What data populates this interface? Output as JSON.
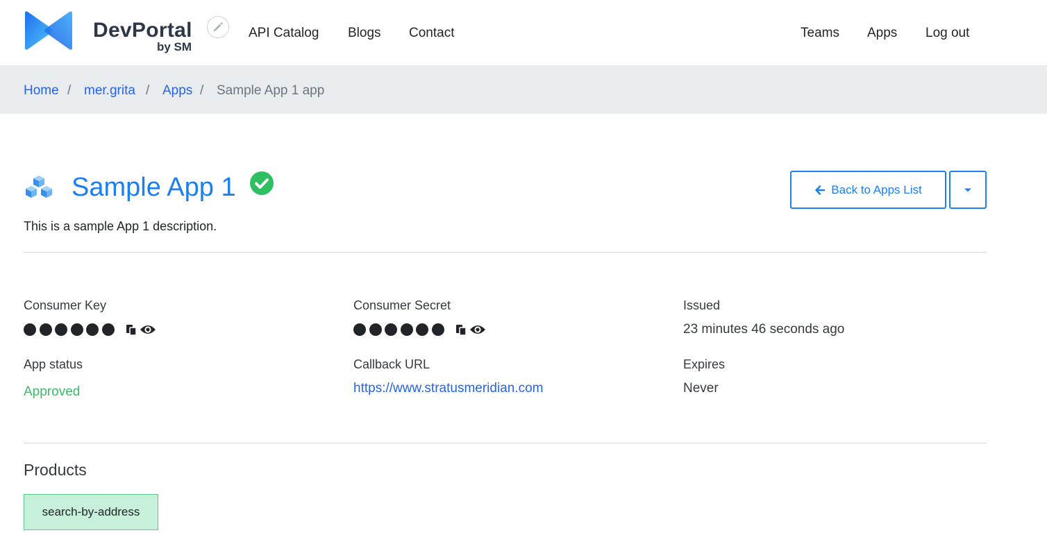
{
  "header": {
    "brand_name": "DevPortal",
    "brand_sub": "by SM",
    "nav": {
      "api_catalog": "API Catalog",
      "blogs": "Blogs",
      "contact": "Contact",
      "teams": "Teams",
      "apps": "Apps",
      "logout": "Log out"
    }
  },
  "breadcrumb": {
    "home": "Home",
    "user": "mer.grita",
    "apps": "Apps",
    "current": "Sample App 1 app",
    "separator": "/"
  },
  "app": {
    "title": "Sample App 1",
    "description": "This is a sample App 1 description.",
    "back_label": "Back to Apps List"
  },
  "details": {
    "consumer_key_label": "Consumer Key",
    "consumer_secret_label": "Consumer Secret",
    "issued_label": "Issued",
    "issued_value": "23 minutes 46 seconds ago",
    "status_label": "App status",
    "status_value": "Approved",
    "callback_label": "Callback URL",
    "callback_value": "https://www.stratusmeridian.com",
    "expires_label": "Expires",
    "expires_value": "Never"
  },
  "products": {
    "title": "Products",
    "items": [
      "search-by-address"
    ]
  },
  "icons": {
    "logo": "devportal-logo",
    "edit": "pencil-icon",
    "app": "cubes-icon",
    "status": "check-circle-icon",
    "back": "arrow-left-icon",
    "dropdown": "caret-down-icon",
    "copy": "copy-icon",
    "reveal": "eye-icon"
  },
  "colors": {
    "accent": "#1a7ff0",
    "link": "#2563eb",
    "success": "#3cb96a",
    "product_bg": "#c6f0d9"
  }
}
